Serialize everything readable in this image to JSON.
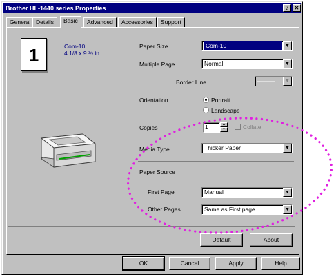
{
  "window": {
    "title": "Brother HL-1440 series Properties",
    "help_btn": "?",
    "close_btn": "✕"
  },
  "tabs": [
    {
      "label": "General"
    },
    {
      "label": "Details"
    },
    {
      "label": "Basic"
    },
    {
      "label": "Advanced"
    },
    {
      "label": "Accessories"
    },
    {
      "label": "Support"
    }
  ],
  "preview": {
    "number": "1",
    "paper_name": "Com-10",
    "paper_dims": "4 1/8 x 9 ½ in"
  },
  "settings": {
    "paper_size_label": "Paper Size",
    "paper_size_value": "Com-10",
    "multiple_page_label": "Multiple Page",
    "multiple_page_value": "Normal",
    "border_line_label": "Border Line",
    "border_line_value": "———",
    "orientation_label": "Orientation",
    "portrait_label": "Portrait",
    "landscape_label": "Landscape",
    "copies_label": "Copies",
    "copies_value": "1",
    "collate_label": "Collate",
    "media_type_label": "Media Type",
    "media_type_value": "Thicker Paper",
    "paper_source_label": "Paper Source",
    "first_page_label": "First Page",
    "first_page_value": "Manual",
    "other_pages_label": "Other Pages",
    "other_pages_value": "Same as First page"
  },
  "buttons": {
    "default": "Default",
    "about": "About",
    "ok": "OK",
    "cancel": "Cancel",
    "apply": "Apply",
    "help": "Help"
  },
  "icons": {
    "dropdown": "▼",
    "spin_up": "▲",
    "spin_down": "▼"
  },
  "colors": {
    "highlight_ellipse": "#e020e0",
    "titlebar": "#000080"
  }
}
